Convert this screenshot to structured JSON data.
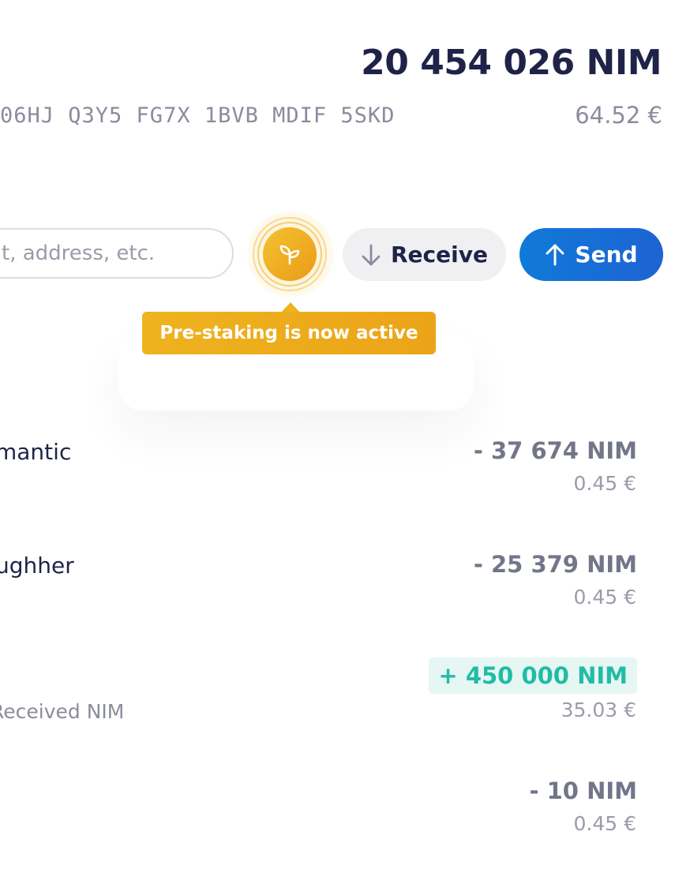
{
  "header": {
    "balance": "20 454 026 NIM",
    "address": "06HJ Q3Y5 FG7X 1BVB MDIF 5SKD",
    "fiat_balance": "64.52 €"
  },
  "actions": {
    "search_placeholder": "t, address, etc.",
    "receive_label": "Receive",
    "send_label": "Send",
    "stake_icon": "sprout-icon"
  },
  "tooltip": {
    "text": "Pre-staking is now active"
  },
  "colors": {
    "accent_gold": "#eeb31f",
    "send_blue": "#0f7ad8",
    "incoming_green": "#21bca5",
    "text_dark": "#1f2348"
  },
  "transactions": [
    {
      "name": "mantic",
      "message": "",
      "amount": "- 37 674 NIM",
      "fiat": "0.45 €",
      "direction": "outgoing"
    },
    {
      "name": "ughher",
      "message": "",
      "amount": "- 25 379 NIM",
      "fiat": "0.45 €",
      "direction": "outgoing"
    },
    {
      "name": "",
      "message": "Received NIM",
      "amount": "+ 450 000 NIM",
      "fiat": "35.03 €",
      "direction": "incoming"
    },
    {
      "name": "",
      "message": "",
      "amount": "- 10 NIM",
      "fiat": "0.45 €",
      "direction": "outgoing"
    }
  ]
}
